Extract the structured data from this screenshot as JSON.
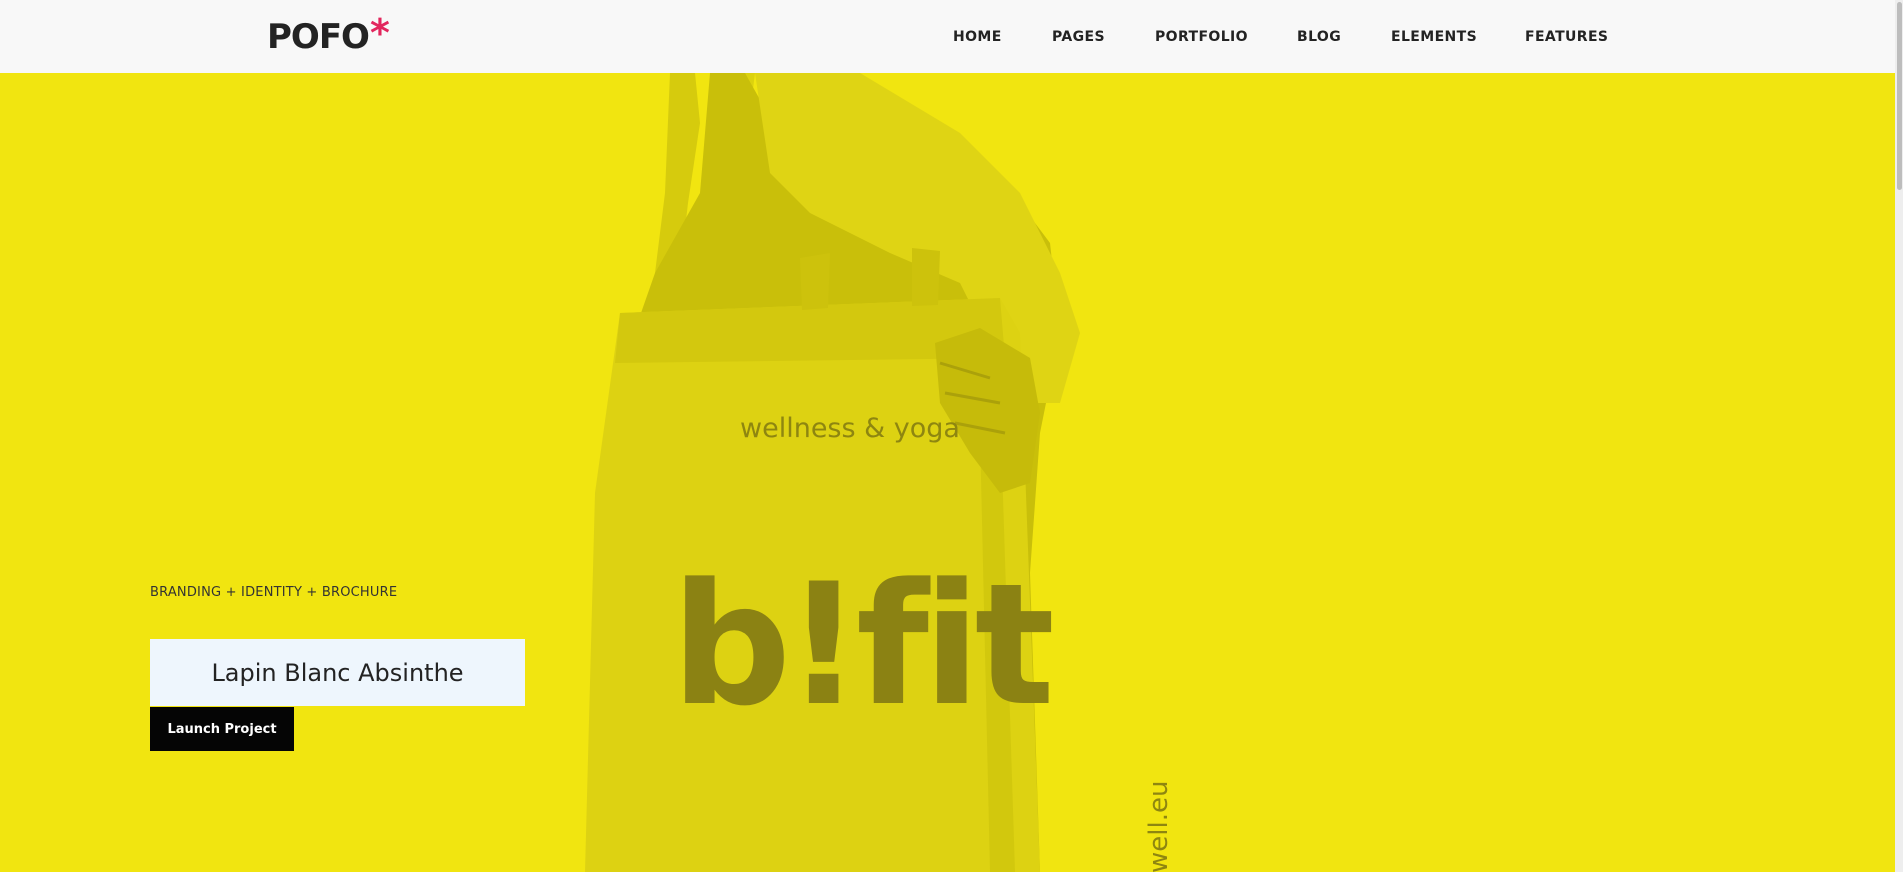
{
  "header": {
    "logo": {
      "text": "POFO",
      "mark": "*"
    },
    "nav": [
      {
        "label": "HOME"
      },
      {
        "label": "PAGES"
      },
      {
        "label": "PORTFOLIO"
      },
      {
        "label": "BLOG"
      },
      {
        "label": "ELEMENTS"
      },
      {
        "label": "FEATURES"
      }
    ]
  },
  "hero": {
    "tagline": "BRANDING + IDENTITY + BROCHURE",
    "title": "Lapin Blanc Absinthe",
    "cta_label": "Launch Project",
    "bag": {
      "subtitle": "wellness & yoga",
      "brand": "b!fit",
      "side_text": "well.eu"
    }
  },
  "colors": {
    "background": "#f1e510",
    "accent": "#e2265d",
    "header_bg": "#f8f8f8",
    "title_box_bg": "#eef6fd",
    "button_bg": "#050505"
  }
}
